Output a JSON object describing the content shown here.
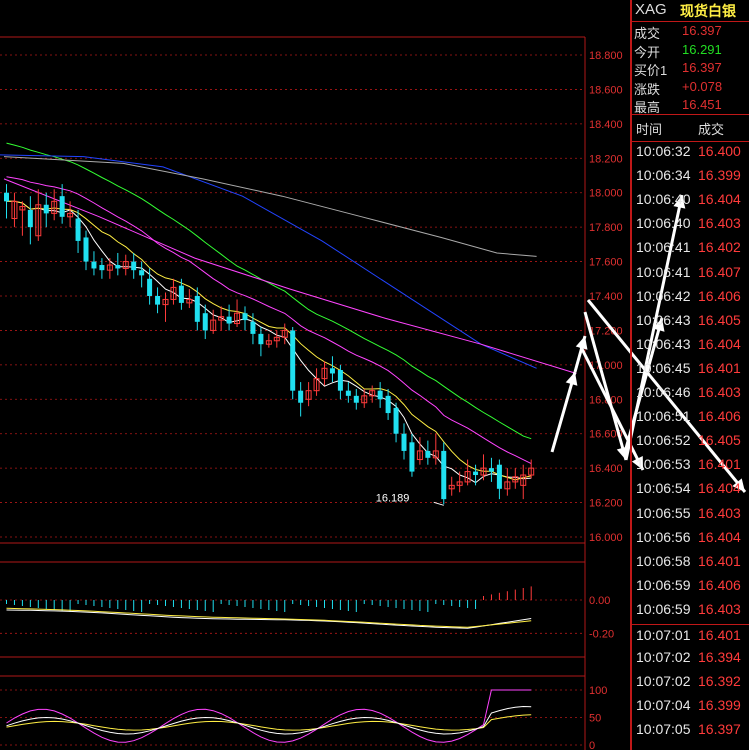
{
  "header": {
    "symbol": "XAG",
    "name": "现货白银"
  },
  "quote": [
    {
      "label": "成交",
      "value": "16.397",
      "color": "#e03030"
    },
    {
      "label": "今开",
      "value": "16.291",
      "color": "#22dd22"
    },
    {
      "label": "买价1",
      "value": "16.397",
      "color": "#e03030"
    },
    {
      "label": "涨跌",
      "value": "+0.078",
      "color": "#e03030"
    },
    {
      "label": "最高",
      "value": "16.451",
      "color": "#e03030"
    }
  ],
  "ticks_header": {
    "time": "时间",
    "price": "成交"
  },
  "ticks": [
    {
      "time": "10:06:32",
      "price": "16.400"
    },
    {
      "time": "10:06:34",
      "price": "16.399"
    },
    {
      "time": "10:06:40",
      "price": "16.404"
    },
    {
      "time": "10:06:40",
      "price": "16.403"
    },
    {
      "time": "10:06:41",
      "price": "16.402"
    },
    {
      "time": "10:06:41",
      "price": "16.407"
    },
    {
      "time": "10:06:42",
      "price": "16.406"
    },
    {
      "time": "10:06:43",
      "price": "16.405"
    },
    {
      "time": "10:06:43",
      "price": "16.404"
    },
    {
      "time": "10:06:45",
      "price": "16.401"
    },
    {
      "time": "10:06:46",
      "price": "16.403"
    },
    {
      "time": "10:06:51",
      "price": "16.406"
    },
    {
      "time": "10:06:52",
      "price": "16.405"
    },
    {
      "time": "10:06:53",
      "price": "16.401"
    },
    {
      "time": "10:06:54",
      "price": "16.404"
    },
    {
      "time": "10:06:55",
      "price": "16.403"
    },
    {
      "time": "10:06:56",
      "price": "16.404"
    },
    {
      "time": "10:06:58",
      "price": "16.401"
    },
    {
      "time": "10:06:59",
      "price": "16.406"
    },
    {
      "time": "10:06:59",
      "price": "16.403"
    },
    {
      "time": "10:07:01",
      "price": "16.401"
    },
    {
      "time": "10:07:02",
      "price": "16.394"
    },
    {
      "time": "10:07:02",
      "price": "16.392"
    },
    {
      "time": "10:07:04",
      "price": "16.399"
    },
    {
      "time": "10:07:05",
      "price": "16.397"
    }
  ],
  "colors": {
    "up": "#ff3b3b",
    "down": "#20e0f0",
    "grid": "#b01818",
    "axis_text": "#e03030",
    "ma5": "#ffffff",
    "ma10": "#ffee44",
    "ma20": "#ff44ff",
    "ma30": "#33ff33",
    "ma60": "#2244ff",
    "ma120": "#aaaaaa",
    "macd_dif": "#ffffff",
    "macd_dea": "#ffee44"
  },
  "chart_data": [
    {
      "type": "candlestick",
      "yaxis_labels": [
        "18.800",
        "18.600",
        "18.400",
        "18.200",
        "18.000",
        "17.800",
        "17.600",
        "17.400",
        "17.200",
        "17.000",
        "16.800",
        "16.600",
        "16.400",
        "16.200",
        "16.000"
      ],
      "ylim": [
        16.0,
        18.8
      ],
      "min_annotation": "16.189",
      "candles": [
        {
          "o": 18.0,
          "c": 17.95,
          "h": 18.05,
          "l": 17.85
        },
        {
          "o": 17.85,
          "c": 17.95,
          "h": 18.0,
          "l": 17.8
        },
        {
          "o": 17.9,
          "c": 17.92,
          "h": 17.95,
          "l": 17.75
        },
        {
          "o": 17.9,
          "c": 17.8,
          "h": 17.98,
          "l": 17.7
        },
        {
          "o": 17.75,
          "c": 17.93,
          "h": 18.02,
          "l": 17.72
        },
        {
          "o": 17.93,
          "c": 17.88,
          "h": 18.0,
          "l": 17.8
        },
        {
          "o": 17.88,
          "c": 17.95,
          "h": 18.02,
          "l": 17.84
        },
        {
          "o": 17.98,
          "c": 17.86,
          "h": 18.05,
          "l": 17.82
        },
        {
          "o": 17.86,
          "c": 17.88,
          "h": 17.95,
          "l": 17.8
        },
        {
          "o": 17.85,
          "c": 17.72,
          "h": 17.9,
          "l": 17.65
        },
        {
          "o": 17.74,
          "c": 17.6,
          "h": 17.78,
          "l": 17.55
        },
        {
          "o": 17.6,
          "c": 17.56,
          "h": 17.66,
          "l": 17.52
        },
        {
          "o": 17.58,
          "c": 17.55,
          "h": 17.62,
          "l": 17.5
        },
        {
          "o": 17.55,
          "c": 17.58,
          "h": 17.62,
          "l": 17.5
        },
        {
          "o": 17.58,
          "c": 17.56,
          "h": 17.65,
          "l": 17.52
        },
        {
          "o": 17.56,
          "c": 17.6,
          "h": 17.64,
          "l": 17.52
        },
        {
          "o": 17.6,
          "c": 17.55,
          "h": 17.65,
          "l": 17.5
        },
        {
          "o": 17.55,
          "c": 17.52,
          "h": 17.6,
          "l": 17.45
        },
        {
          "o": 17.5,
          "c": 17.4,
          "h": 17.56,
          "l": 17.35
        },
        {
          "o": 17.4,
          "c": 17.35,
          "h": 17.45,
          "l": 17.3
        },
        {
          "o": 17.35,
          "c": 17.38,
          "h": 17.42,
          "l": 17.25
        },
        {
          "o": 17.38,
          "c": 17.45,
          "h": 17.5,
          "l": 17.35
        },
        {
          "o": 17.46,
          "c": 17.36,
          "h": 17.5,
          "l": 17.32
        },
        {
          "o": 17.36,
          "c": 17.38,
          "h": 17.44,
          "l": 17.33
        },
        {
          "o": 17.4,
          "c": 17.25,
          "h": 17.45,
          "l": 17.2
        },
        {
          "o": 17.3,
          "c": 17.2,
          "h": 17.35,
          "l": 17.15
        },
        {
          "o": 17.2,
          "c": 17.26,
          "h": 17.32,
          "l": 17.18
        },
        {
          "o": 17.26,
          "c": 17.28,
          "h": 17.34,
          "l": 17.2
        },
        {
          "o": 17.28,
          "c": 17.24,
          "h": 17.35,
          "l": 17.2
        },
        {
          "o": 17.24,
          "c": 17.3,
          "h": 17.38,
          "l": 17.22
        },
        {
          "o": 17.3,
          "c": 17.26,
          "h": 17.34,
          "l": 17.2
        },
        {
          "o": 17.25,
          "c": 17.18,
          "h": 17.3,
          "l": 17.12
        },
        {
          "o": 17.18,
          "c": 17.12,
          "h": 17.22,
          "l": 17.05
        },
        {
          "o": 17.12,
          "c": 17.14,
          "h": 17.18,
          "l": 17.1
        },
        {
          "o": 17.14,
          "c": 17.16,
          "h": 17.2,
          "l": 17.1
        },
        {
          "o": 17.16,
          "c": 17.2,
          "h": 17.24,
          "l": 17.12
        },
        {
          "o": 17.2,
          "c": 16.85,
          "h": 17.22,
          "l": 16.8
        },
        {
          "o": 16.85,
          "c": 16.78,
          "h": 16.9,
          "l": 16.7
        },
        {
          "o": 16.8,
          "c": 16.85,
          "h": 16.9,
          "l": 16.76
        },
        {
          "o": 16.85,
          "c": 16.92,
          "h": 16.98,
          "l": 16.82
        },
        {
          "o": 16.92,
          "c": 16.98,
          "h": 17.02,
          "l": 16.88
        },
        {
          "o": 16.98,
          "c": 16.95,
          "h": 17.05,
          "l": 16.9
        },
        {
          "o": 16.97,
          "c": 16.85,
          "h": 17.0,
          "l": 16.8
        },
        {
          "o": 16.85,
          "c": 16.82,
          "h": 16.9,
          "l": 16.78
        },
        {
          "o": 16.82,
          "c": 16.78,
          "h": 16.86,
          "l": 16.74
        },
        {
          "o": 16.78,
          "c": 16.82,
          "h": 16.86,
          "l": 16.75
        },
        {
          "o": 16.82,
          "c": 16.85,
          "h": 16.88,
          "l": 16.78
        },
        {
          "o": 16.85,
          "c": 16.8,
          "h": 16.9,
          "l": 16.75
        },
        {
          "o": 16.82,
          "c": 16.72,
          "h": 16.86,
          "l": 16.68
        },
        {
          "o": 16.75,
          "c": 16.6,
          "h": 16.78,
          "l": 16.55
        },
        {
          "o": 16.6,
          "c": 16.5,
          "h": 16.66,
          "l": 16.45
        },
        {
          "o": 16.55,
          "c": 16.38,
          "h": 16.6,
          "l": 16.35
        },
        {
          "o": 16.45,
          "c": 16.5,
          "h": 16.58,
          "l": 16.42
        },
        {
          "o": 16.5,
          "c": 16.46,
          "h": 16.56,
          "l": 16.42
        },
        {
          "o": 16.46,
          "c": 16.5,
          "h": 16.6,
          "l": 16.42
        },
        {
          "o": 16.5,
          "c": 16.22,
          "h": 16.55,
          "l": 16.19
        },
        {
          "o": 16.28,
          "c": 16.3,
          "h": 16.35,
          "l": 16.24
        },
        {
          "o": 16.3,
          "c": 16.32,
          "h": 16.38,
          "l": 16.26
        },
        {
          "o": 16.32,
          "c": 16.38,
          "h": 16.45,
          "l": 16.3
        },
        {
          "o": 16.38,
          "c": 16.36,
          "h": 16.42,
          "l": 16.3
        },
        {
          "o": 16.36,
          "c": 16.4,
          "h": 16.48,
          "l": 16.33
        },
        {
          "o": 16.4,
          "c": 16.38,
          "h": 16.46,
          "l": 16.32
        },
        {
          "o": 16.42,
          "c": 16.28,
          "h": 16.45,
          "l": 16.22
        },
        {
          "o": 16.28,
          "c": 16.32,
          "h": 16.4,
          "l": 16.24
        },
        {
          "o": 16.32,
          "c": 16.35,
          "h": 16.4,
          "l": 16.28
        },
        {
          "o": 16.3,
          "c": 16.36,
          "h": 16.42,
          "l": 16.22
        },
        {
          "o": 16.36,
          "c": 16.4,
          "h": 16.45,
          "l": 16.34
        }
      ]
    },
    {
      "type": "bar",
      "name": "MACD",
      "yaxis_labels": [
        "0.00",
        "-0.20"
      ],
      "ylim": [
        -0.3,
        0.15
      ]
    },
    {
      "type": "line",
      "name": "KDJ",
      "yaxis_labels": [
        "100",
        "50",
        "0"
      ],
      "ylim": [
        0,
        100
      ]
    }
  ]
}
